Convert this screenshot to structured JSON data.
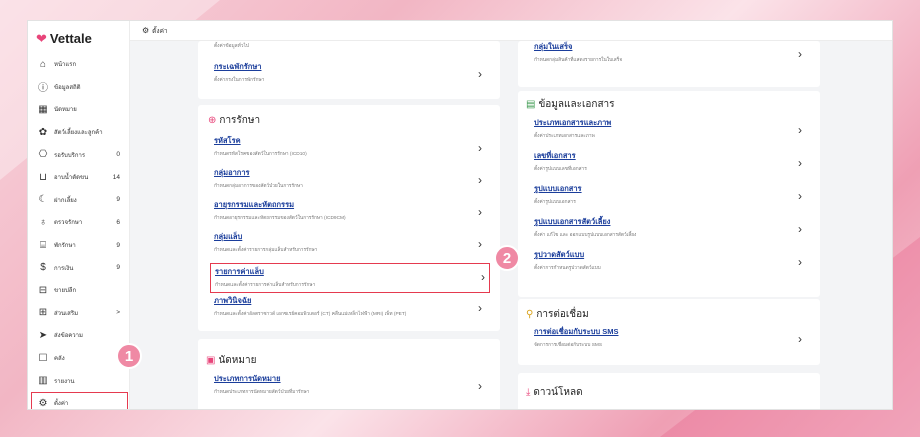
{
  "app": {
    "logo": "Vettale"
  },
  "topbar": {
    "label": "ตั้งค่า"
  },
  "sidebar": {
    "items": [
      {
        "icon": "home-icon",
        "label": "หน้าแรก",
        "count": ""
      },
      {
        "icon": "info-icon",
        "label": "ข้อมูลสถิติ",
        "count": ""
      },
      {
        "icon": "calendar-icon",
        "label": "นัดหมาย",
        "count": ""
      },
      {
        "icon": "pet-icon",
        "label": "สัตว์เลี้ยงและลูกค้า",
        "count": ""
      },
      {
        "icon": "service-icon",
        "label": "รอรับบริการ",
        "count": "0"
      },
      {
        "icon": "bath-icon",
        "label": "อาบน้ำตัดขน",
        "count": "14"
      },
      {
        "icon": "moon-icon",
        "label": "ฝากเลี้ยง",
        "count": "9"
      },
      {
        "icon": "stethoscope-icon",
        "label": "ตรวจรักษา",
        "count": "6"
      },
      {
        "icon": "bed-icon",
        "label": "พักรักษา",
        "count": "9"
      },
      {
        "icon": "money-icon",
        "label": "การเงิน",
        "count": "9"
      },
      {
        "icon": "store-icon",
        "label": "ขายปลีก",
        "count": ""
      },
      {
        "icon": "plus-square-icon",
        "label": "ส่วนเสริม",
        "count": ">"
      },
      {
        "icon": "send-icon",
        "label": "ส่งข้อความ",
        "count": ""
      },
      {
        "icon": "box-icon",
        "label": "คลัง",
        "count": ""
      },
      {
        "icon": "chart-icon",
        "label": "รายงาน",
        "count": ""
      },
      {
        "icon": "gear-icon",
        "label": "ตั้งค่า",
        "count": ""
      }
    ]
  },
  "col1": {
    "top_rows": [
      {
        "title": "",
        "desc": "ตั้งค่าข้อมูลทั่วไป"
      },
      {
        "title": "กระเฉพักรักษา",
        "desc": "ตั้งค่ากรงในการพักรักษา"
      }
    ],
    "treatment": {
      "heading": "การรักษา",
      "rows": [
        {
          "title": "รหัสโรค",
          "desc": "กำหนดรหัสโรคของสัตว์ในการรักษา (ICD10)"
        },
        {
          "title": "กลุ่มอาการ",
          "desc": "กำหนดกลุ่มอาการของสัตว์ป่วยในการรักษา"
        },
        {
          "title": "อายุรกรรมและหัตถกรรม",
          "desc": "กำหนดอายุรกรรมและหัตถกรรมของสัตว์ในการรักษา (ICD9CM)"
        },
        {
          "title": "กลุ่มแล็บ",
          "desc": "กำหนดและตั้งค่ารายการกลุ่มแล็บสำหรับการรักษา"
        },
        {
          "title": "รายการค่าแล็บ",
          "desc": "กำหนดและตั้งค่ารายการค่าแล็บสำหรับการรักษา"
        },
        {
          "title": "ภาพวินิจฉัย",
          "desc": "กำหนดและตั้งค่าอัลตราซาวด์ เอกซเรย์คอมพิวเตอร์ (CT) คลื่นแม่เหล็กไฟฟ้า (MRI) เพ็ท (PET)"
        }
      ]
    },
    "appointment": {
      "heading": "นัดหมาย",
      "rows": [
        {
          "title": "ประเภทการนัดหมาย",
          "desc": "กำหนดประเภทการนัดหมายสัตว์ป่วยที่มารักษา"
        }
      ]
    }
  },
  "col2": {
    "top_rows": [
      {
        "title": "กลุ่มในเสร็จ",
        "desc": "กำหนดกลุ่มสินค้าที่แสดงรายการในใบเสร็จ"
      }
    ],
    "docs": {
      "heading": "ข้อมูลและเอกสาร",
      "rows": [
        {
          "title": "ประเภทเอกสารและภาพ",
          "desc": "ตั้งค่าประเภทเอกสารและภาพ"
        },
        {
          "title": "เลขที่เอกสาร",
          "desc": "ตั้งค่ารูปแบบเลขที่เอกสาร"
        },
        {
          "title": "รูปแบบเอกสาร",
          "desc": "ตั้งค่ารูปแบบเอกสาร"
        },
        {
          "title": "รูปแบบเอกสารสัตว์เลี้ยง",
          "desc": "ตั้งค่า แก้ไข และ ออกแบบรูปแบบเอกสารสัตว์เลี้ยง"
        },
        {
          "title": "รูปวาดสัตว์แบบ",
          "desc": "ตั้งค่าการกำหนดรูปวาดสัตว์แบบ"
        }
      ]
    },
    "connect": {
      "heading": "การต่อเชื่อม",
      "rows": [
        {
          "title": "การต่อเชื่อมกับระบบ SMS",
          "desc": "จัดการการเชื่อมต่อกับระบบ SMS"
        }
      ]
    },
    "download": {
      "heading": "ดาวน์โหลด"
    }
  },
  "annotations": {
    "badge1": "1",
    "badge2": "2"
  },
  "colors": {
    "accent": "#e8457a",
    "link": "#1a3d9b",
    "highlight": "#e53a4f",
    "badge": "#ef89a4"
  }
}
